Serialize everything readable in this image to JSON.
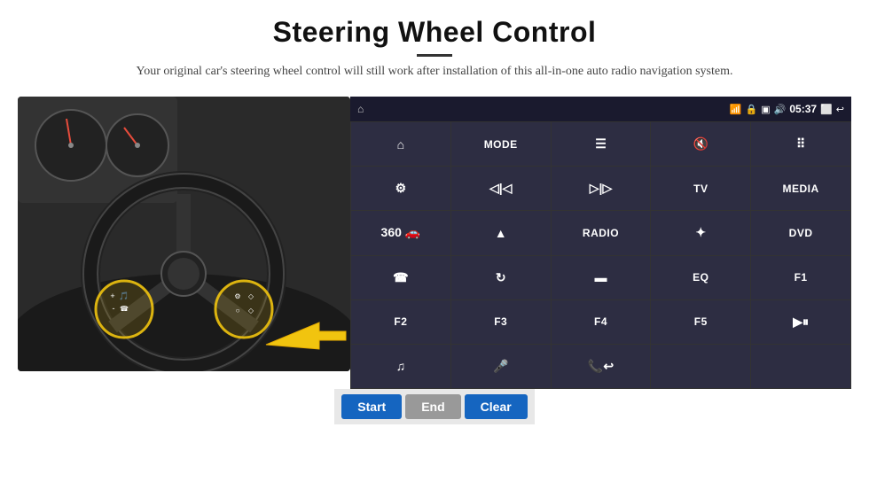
{
  "header": {
    "title": "Steering Wheel Control",
    "subtitle": "Your original car's steering wheel control will still work after installation of this all-in-one auto radio navigation system."
  },
  "status_bar": {
    "time": "05:37",
    "wifi_icon": "📶",
    "lock_icon": "🔒",
    "sd_icon": "💾",
    "bt_icon": "🔊",
    "window_icon": "⬛",
    "back_icon": "↩"
  },
  "grid_buttons": [
    {
      "id": "r1c1",
      "type": "icon",
      "icon": "⌂",
      "label": "home"
    },
    {
      "id": "r1c2",
      "type": "text",
      "icon": "MODE",
      "label": "mode"
    },
    {
      "id": "r1c3",
      "type": "icon",
      "icon": "≡",
      "label": "menu"
    },
    {
      "id": "r1c4",
      "type": "icon",
      "icon": "🔇",
      "label": "mute"
    },
    {
      "id": "r1c5",
      "type": "icon",
      "icon": "⠿",
      "label": "apps"
    },
    {
      "id": "r2c1",
      "type": "icon",
      "icon": "⚙",
      "label": "settings"
    },
    {
      "id": "r2c2",
      "type": "icon",
      "icon": "⏮",
      "label": "prev"
    },
    {
      "id": "r2c3",
      "type": "icon",
      "icon": "⏭",
      "label": "next"
    },
    {
      "id": "r2c4",
      "type": "text",
      "icon": "TV",
      "label": "tv"
    },
    {
      "id": "r2c5",
      "type": "text",
      "icon": "MEDIA",
      "label": "media"
    },
    {
      "id": "r3c1",
      "type": "icon",
      "icon": "📷",
      "label": "camera-360"
    },
    {
      "id": "r3c2",
      "type": "icon",
      "icon": "▲",
      "label": "eject"
    },
    {
      "id": "r3c3",
      "type": "text",
      "icon": "RADIO",
      "label": "radio"
    },
    {
      "id": "r3c4",
      "type": "icon",
      "icon": "☀",
      "label": "brightness"
    },
    {
      "id": "r3c5",
      "type": "text",
      "icon": "DVD",
      "label": "dvd"
    },
    {
      "id": "r4c1",
      "type": "icon",
      "icon": "📞",
      "label": "phone"
    },
    {
      "id": "r4c2",
      "type": "icon",
      "icon": "🔄",
      "label": "rotate"
    },
    {
      "id": "r4c3",
      "type": "icon",
      "icon": "—",
      "label": "minus"
    },
    {
      "id": "r4c4",
      "type": "text",
      "icon": "EQ",
      "label": "eq"
    },
    {
      "id": "r4c5",
      "type": "text",
      "icon": "F1",
      "label": "f1"
    },
    {
      "id": "r5c1",
      "type": "text",
      "icon": "F2",
      "label": "f2"
    },
    {
      "id": "r5c2",
      "type": "text",
      "icon": "F3",
      "label": "f3"
    },
    {
      "id": "r5c3",
      "type": "text",
      "icon": "F4",
      "label": "f4"
    },
    {
      "id": "r5c4",
      "type": "text",
      "icon": "F5",
      "label": "f5"
    },
    {
      "id": "r5c5",
      "type": "icon",
      "icon": "⏯",
      "label": "play-pause"
    },
    {
      "id": "r6c1",
      "type": "icon",
      "icon": "♪",
      "label": "music"
    },
    {
      "id": "r6c2",
      "type": "icon",
      "icon": "🎤",
      "label": "mic"
    },
    {
      "id": "r6c3",
      "type": "icon",
      "icon": "📞/↩",
      "label": "call-end"
    },
    {
      "id": "r6c4",
      "type": "empty",
      "icon": "",
      "label": "empty1"
    },
    {
      "id": "r6c5",
      "type": "empty",
      "icon": "",
      "label": "empty2"
    }
  ],
  "action_buttons": {
    "start_label": "Start",
    "end_label": "End",
    "clear_label": "Clear"
  }
}
